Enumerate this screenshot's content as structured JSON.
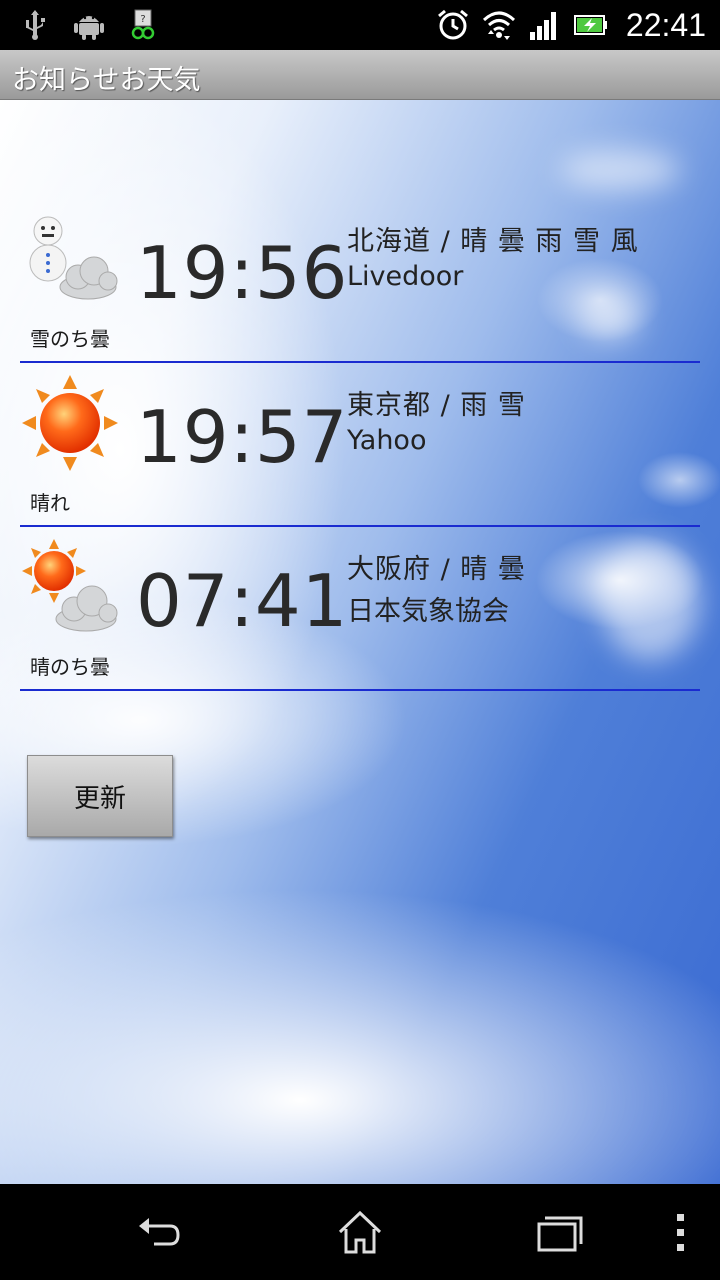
{
  "status_bar": {
    "time": "22:41",
    "left_icons": [
      "usb-icon",
      "android-debug-icon",
      "notification-app-icon"
    ],
    "right_icons": [
      "alarm-icon",
      "wifi-icon",
      "signal-icon",
      "battery-charging-icon"
    ]
  },
  "title_bar": {
    "title": "お知らせお天気"
  },
  "forecasts": [
    {
      "icon": "snowman-cloud-icon",
      "condition": "雪のち曇",
      "time": "19:56",
      "area": "北海道 / 晴 曇 雨 雪 風",
      "source": "Livedoor"
    },
    {
      "icon": "sun-icon",
      "condition": "晴れ",
      "time": "19:57",
      "area": "東京都 / 雨 雪",
      "source": "Yahoo"
    },
    {
      "icon": "sun-cloud-icon",
      "condition": "晴のち曇",
      "time": "07:41",
      "area": "大阪府 / 晴 曇",
      "source": "日本気象協会"
    }
  ],
  "actions": {
    "update_label": "更新"
  },
  "nav_bar": {
    "buttons": [
      "back-icon",
      "home-icon",
      "recent-apps-icon",
      "menu-icon"
    ]
  },
  "colors": {
    "divider": "#1a2bd0",
    "sky_blue": "#3a6ad2"
  }
}
